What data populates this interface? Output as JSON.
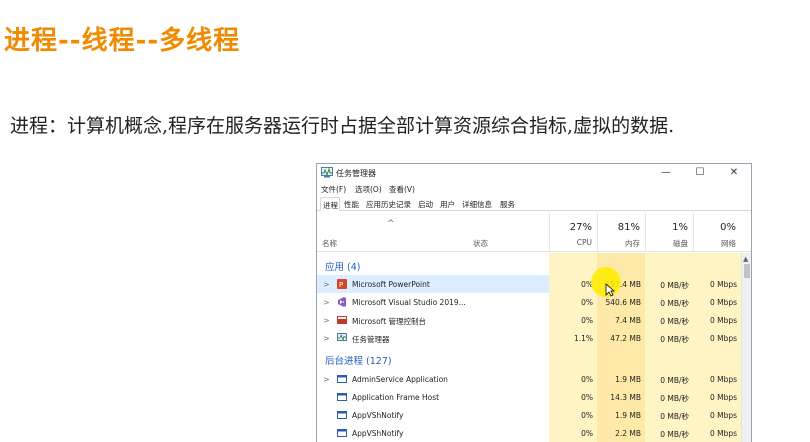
{
  "slide": {
    "title": "进程--线程--多线程",
    "body": "进程：计算机概念,程序在服务器运行时占据全部计算资源综合指标,虚拟的数据."
  },
  "window": {
    "title": "任务管理器",
    "minimize": "—",
    "maximize": "☐",
    "close": "✕",
    "menus": [
      "文件(F)",
      "选项(O)",
      "查看(V)"
    ],
    "tabs": [
      "进程",
      "性能",
      "应用历史记录",
      "启动",
      "用户",
      "详细信息",
      "服务"
    ],
    "active_tab": "进程"
  },
  "columns": {
    "name": "名称",
    "status": "状态",
    "cpu": {
      "pct": "27%",
      "label": "CPU"
    },
    "memory": {
      "pct": "81%",
      "label": "内存"
    },
    "disk": {
      "pct": "1%",
      "label": "磁盘"
    },
    "network": {
      "pct": "0%",
      "label": "网络"
    }
  },
  "groups": {
    "apps": "应用 (4)",
    "background": "后台进程 (127)"
  },
  "apps": [
    {
      "name": "Microsoft PowerPoint",
      "cpu": "0%",
      "mem": "157.4 MB",
      "disk": "0 MB/秒",
      "net": "0 Mbps"
    },
    {
      "name": "Microsoft Visual Studio 2019...",
      "cpu": "0%",
      "mem": "540.6 MB",
      "disk": "0 MB/秒",
      "net": "0 Mbps"
    },
    {
      "name": "Microsoft 管理控制台",
      "cpu": "0%",
      "mem": "7.4 MB",
      "disk": "0 MB/秒",
      "net": "0 Mbps"
    },
    {
      "name": "任务管理器",
      "cpu": "1.1%",
      "mem": "47.2 MB",
      "disk": "0 MB/秒",
      "net": "0 Mbps"
    }
  ],
  "background": [
    {
      "name": "AdminService Application",
      "cpu": "0%",
      "mem": "1.9 MB",
      "disk": "0 MB/秒",
      "net": "0 Mbps"
    },
    {
      "name": "Application Frame Host",
      "cpu": "0%",
      "mem": "14.3 MB",
      "disk": "0 MB/秒",
      "net": "0 Mbps"
    },
    {
      "name": "AppVShNotify",
      "cpu": "0%",
      "mem": "1.9 MB",
      "disk": "0 MB/秒",
      "net": "0 Mbps"
    },
    {
      "name": "AppVShNotify",
      "cpu": "0%",
      "mem": "2.2 MB",
      "disk": "0 MB/秒",
      "net": "0 Mbps"
    }
  ],
  "colors": {
    "title_orange": "#f08a00",
    "group_blue": "#1f5fbf",
    "col_yellow": "#fff4c4",
    "col_yellow_dark": "#ffe9a8"
  }
}
